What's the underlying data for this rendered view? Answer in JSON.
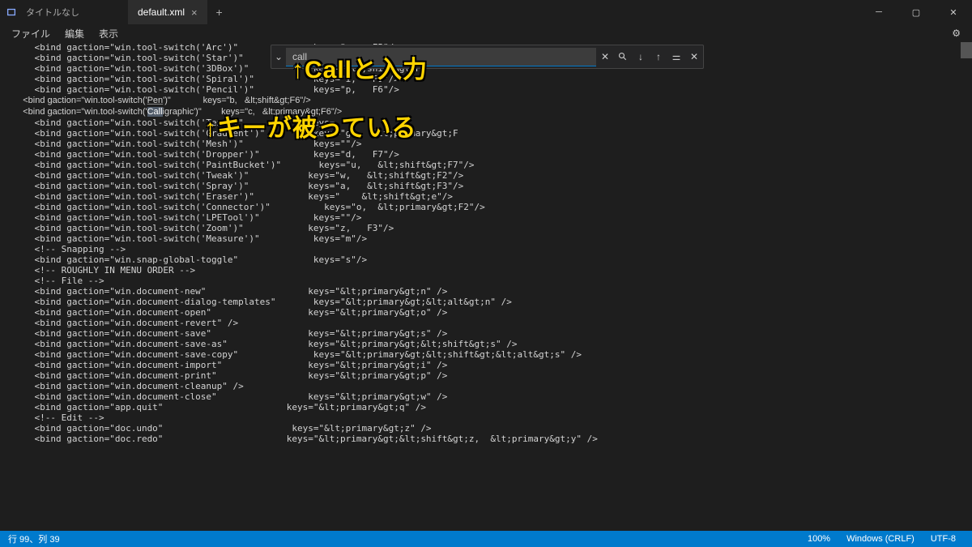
{
  "titlebar": {
    "title": "タイトルなし"
  },
  "tabs": {
    "active": "default.xml"
  },
  "menubar": {
    "file": "ファイル",
    "edit": "編集",
    "view": "表示"
  },
  "search": {
    "value": "call"
  },
  "annotations": {
    "top": "↑Callと入力",
    "mid": "↑キーが被っている"
  },
  "statusbar": {
    "pos": "行 99、列 39",
    "zoom": "100%",
    "eol": "Windows (CRLF)",
    "enc": "UTF-8"
  },
  "code": {
    "l1": "    <bind gaction=\"win.tool-switch('Arc')\"              keys=\"e,   F5\"/>",
    "l2": "    <bind gaction=\"win.tool-switch('Star')\"            keys=\"asterisk, &lt;sh",
    "l3": "    <bind gaction=\"win.tool-switch('3DBox')\"            keys=\"&lt;shift&gt;F4",
    "l4": "    <bind gaction=\"win.tool-switch('Spiral')\"           keys=\"i,   F9\"/>",
    "l5": "",
    "l6": "    <bind gaction=\"win.tool-switch('Pencil')\"           keys=\"p,   F6\"/>",
    "l7a": "    <bind gaction=\"win.tool-switch('",
    "l7b": "Pen",
    "l7c": "')\"             keys=\"b,   &lt;shift&gt;F6\"/>",
    "l8a": "    <bind gaction=\"win.tool-switch('",
    "l8b": "Call",
    "l8c": "igraphic')\"        keys=\"c,   &lt;primary&gt;F6\"/>",
    "l9": "    <bind gaction=\"win.tool-switch('Text')\"            keys=",
    "l10": "",
    "l11": "    <bind gaction=\"win.tool-switch('Gradient')\"         keys=\"g,   &lt;primary&gt;F",
    "l12": "    <bind gaction=\"win.tool-switch('Mesh')\"             keys=\"\"/>",
    "l13": "    <bind gaction=\"win.tool-switch('Dropper')\"          keys=\"d,   F7\"/>",
    "l14": "    <bind gaction=\"win.tool-switch('PaintBucket')\"       keys=\"u,   &lt;shift&gt;F7\"/>",
    "l15": "",
    "l16": "    <bind gaction=\"win.tool-switch('Tweak')\"           keys=\"w,   &lt;shift&gt;F2\"/>",
    "l17": "    <bind gaction=\"win.tool-switch('Spray')\"           keys=\"a,   &lt;shift&gt;F3\"/>",
    "l18": "    <bind gaction=\"win.tool-switch('Eraser')\"          keys=\"    &lt;shift&gt;e\"/>",
    "l19": "    <bind gaction=\"win.tool-switch('Connector')\"          keys=\"o,  &lt;primary&gt;F2\"/>",
    "l20": "    <bind gaction=\"win.tool-switch('LPETool')\"          keys=\"\"/>",
    "l21": "",
    "l22": "    <bind gaction=\"win.tool-switch('Zoom')\"            keys=\"z,   F3\"/>",
    "l23": "    <bind gaction=\"win.tool-switch('Measure')\"          keys=\"m\"/>",
    "l24": "",
    "l25": "    <!-- Snapping -->",
    "l26": "    <bind gaction=\"win.snap-global-toggle\"              keys=\"s\"/>",
    "l27": "",
    "l28": "",
    "l29": "    <!-- ROUGHLY IN MENU ORDER -->",
    "l30": "",
    "l31": "    <!-- File -->",
    "l32": "    <bind gaction=\"win.document-new\"                   keys=\"&lt;primary&gt;n\" />",
    "l33": "    <bind gaction=\"win.document-dialog-templates\"       keys=\"&lt;primary&gt;&lt;alt&gt;n\" />",
    "l34": "    <bind gaction=\"win.document-open\"                  keys=\"&lt;primary&gt;o\" />",
    "l35": "    <bind gaction=\"win.document-revert\" />",
    "l36": "    <bind gaction=\"win.document-save\"                  keys=\"&lt;primary&gt;s\" />",
    "l37": "    <bind gaction=\"win.document-save-as\"               keys=\"&lt;primary&gt;&lt;shift&gt;s\" />",
    "l38": "    <bind gaction=\"win.document-save-copy\"              keys=\"&lt;primary&gt;&lt;shift&gt;&lt;alt&gt;s\" />",
    "l39": "    <bind gaction=\"win.document-import\"                keys=\"&lt;primary&gt;i\" />",
    "l40": "    <bind gaction=\"win.document-print\"                 keys=\"&lt;primary&gt;p\" />",
    "l41": "    <bind gaction=\"win.document-cleanup\" />",
    "l42": "    <bind gaction=\"win.document-close\"                 keys=\"&lt;primary&gt;w\" />",
    "l43": "    <bind gaction=\"app.quit\"                       keys=\"&lt;primary&gt;q\" />",
    "l44": "",
    "l45": "    <!-- Edit -->",
    "l46": "    <bind gaction=\"doc.undo\"                        keys=\"&lt;primary&gt;z\" />",
    "l47": "    <bind gaction=\"doc.redo\"                       keys=\"&lt;primary&gt;&lt;shift&gt;z,  &lt;primary&gt;y\" />"
  }
}
